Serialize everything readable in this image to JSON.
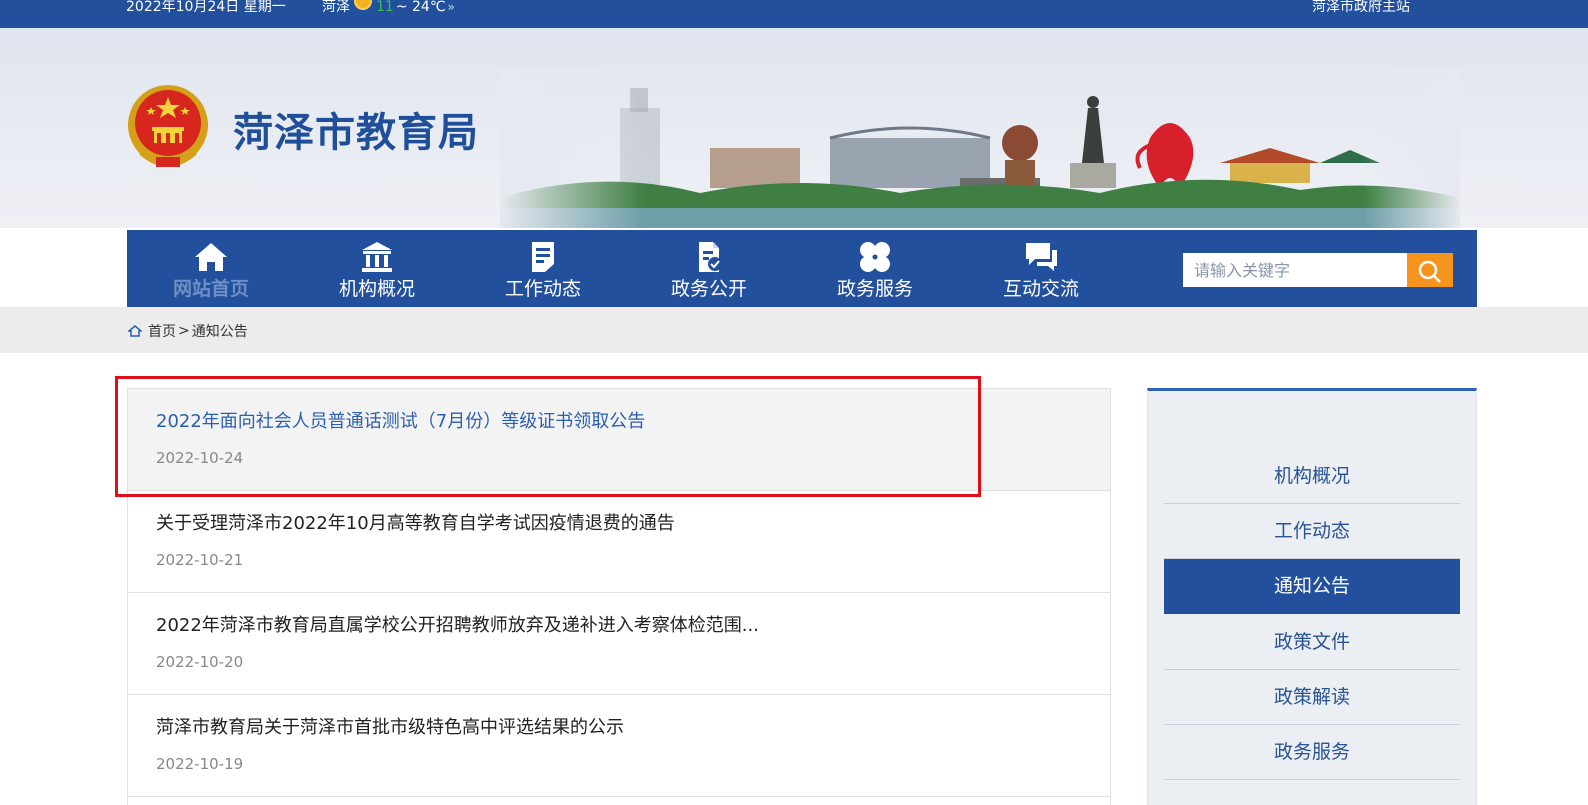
{
  "topbar": {
    "date": "2022年10月24日 星期一",
    "city": "菏泽",
    "temp_low": "11",
    "temp_high": "~ 24℃",
    "weather_icon": "sun-icon",
    "gov_link": "菏泽市政府主站"
  },
  "header": {
    "title": "菏泽市教育局",
    "emblem": "national-emblem",
    "banner": "city-skyline-illustration"
  },
  "nav": {
    "items": [
      {
        "label": "网站首页",
        "icon": "home-icon"
      },
      {
        "label": "机构概况",
        "icon": "institution-icon"
      },
      {
        "label": "工作动态",
        "icon": "document-icon"
      },
      {
        "label": "政务公开",
        "icon": "file-check-icon"
      },
      {
        "label": "政务服务",
        "icon": "clover-icon"
      },
      {
        "label": "互动交流",
        "icon": "chat-icon"
      }
    ],
    "search_placeholder": "请输入关键字"
  },
  "breadcrumb": {
    "home": "首页",
    "separator": ">",
    "current": "通知公告"
  },
  "news": [
    {
      "title": "2022年面向社会人员普通话测试（7月份）等级证书领取公告",
      "date": "2022-10-24"
    },
    {
      "title": "关于受理菏泽市2022年10月高等教育自学考试因疫情退费的通告",
      "date": "2022-10-21"
    },
    {
      "title": "2022年菏泽市教育局直属学校公开招聘教师放弃及递补进入考察体检范围...",
      "date": "2022-10-20"
    },
    {
      "title": "菏泽市教育局关于菏泽市首批市级特色高中评选结果的公示",
      "date": "2022-10-19"
    }
  ],
  "sidebar": {
    "items": [
      "机构概况",
      "工作动态",
      "通知公告",
      "政策文件",
      "政策解读",
      "政务服务"
    ],
    "active": "通知公告"
  },
  "colors": {
    "primary": "#22509c",
    "accent": "#f7941e",
    "link": "#2a5fb0",
    "highlight": "#e0101a"
  }
}
